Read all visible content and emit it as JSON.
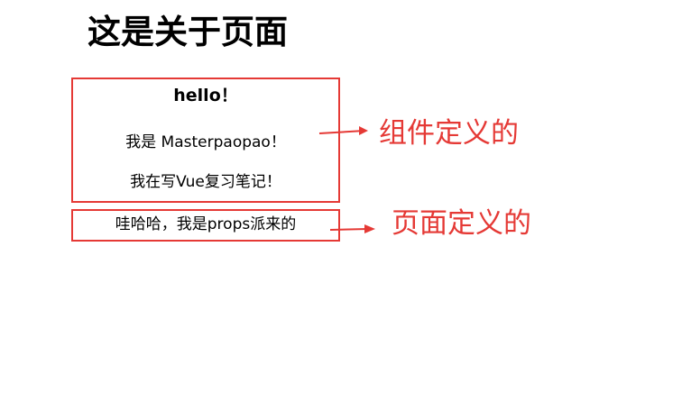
{
  "page": {
    "title": "这是关于页面"
  },
  "component": {
    "heading": "hello！",
    "line1": "我是 Masterpaopao！",
    "line2": "我在写Vue复习笔记！"
  },
  "page_content": {
    "text": "哇哈哈，我是props派来的"
  },
  "annotations": {
    "component_label": "组件定义的",
    "page_label": "页面定义的",
    "color": "#e53935"
  },
  "icons": {
    "arrow": "arrow-right-icon"
  }
}
